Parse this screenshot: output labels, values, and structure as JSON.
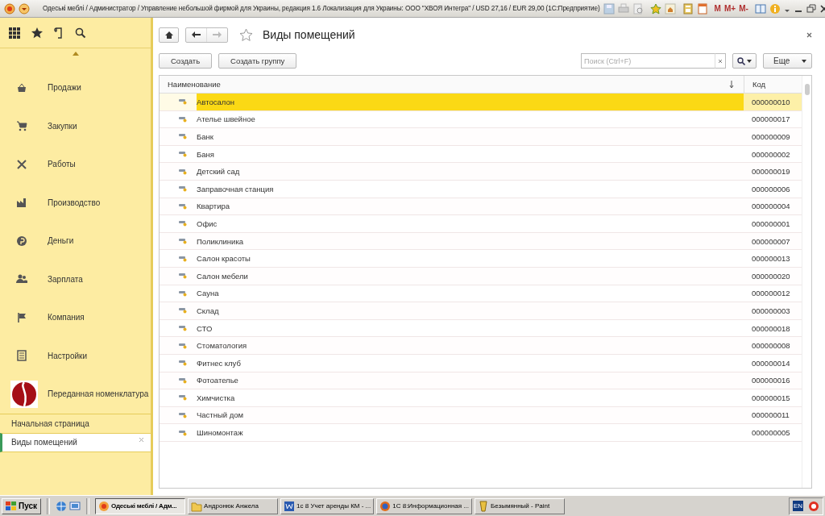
{
  "window": {
    "title": "Одеські меблі / Администратор / Управление небольшой фирмой для Украины, редакция 1.6 Локализация для Украины: ООО \"ХВОЯ Интегра\" / USD 27,16 / EUR 29,00  (1С:Предприятие)",
    "memory_buttons": [
      "M",
      "M+",
      "M-"
    ]
  },
  "sidebar": {
    "sections": [
      {
        "kind": "section",
        "label": "Продажи"
      },
      {
        "kind": "section",
        "label": "Закупки"
      },
      {
        "kind": "section",
        "label": "Работы"
      },
      {
        "kind": "section",
        "label": "Производство"
      },
      {
        "kind": "section",
        "label": "Деньги"
      },
      {
        "kind": "section",
        "label": "Зарплата"
      },
      {
        "kind": "section",
        "label": "Компания"
      },
      {
        "kind": "section",
        "label": "Настройки"
      },
      {
        "kind": "logo",
        "label": "Переданная номенклатура"
      }
    ],
    "open_windows": [
      {
        "label": "Начальная страница",
        "selected": false
      },
      {
        "label": "Виды помещений",
        "selected": true
      }
    ]
  },
  "page": {
    "title": "Виды помещений",
    "buttons": [
      "Создать",
      "Создать группу"
    ],
    "search": {
      "placeholder": "Поиск (Ctrl+F)"
    },
    "more_button": "Еще",
    "table": {
      "columns": [
        {
          "label": "Наименование",
          "sorted": true
        },
        {
          "label": "Код",
          "sorted": false
        }
      ],
      "rows": [
        {
          "name": "Автосалон",
          "code": "000000010",
          "selected": true
        },
        {
          "name": "Ателье швейное",
          "code": "000000017",
          "selected": false
        },
        {
          "name": "Банк",
          "code": "000000009",
          "selected": false
        },
        {
          "name": "Баня",
          "code": "000000002",
          "selected": false
        },
        {
          "name": "Детский сад",
          "code": "000000019",
          "selected": false
        },
        {
          "name": "Заправочная станция",
          "code": "000000006",
          "selected": false
        },
        {
          "name": "Квартира",
          "code": "000000004",
          "selected": false
        },
        {
          "name": "Офис",
          "code": "000000001",
          "selected": false
        },
        {
          "name": "Поликлиника",
          "code": "000000007",
          "selected": false
        },
        {
          "name": "Салон красоты",
          "code": "000000013",
          "selected": false
        },
        {
          "name": "Салон мебели",
          "code": "000000020",
          "selected": false
        },
        {
          "name": "Сауна",
          "code": "000000012",
          "selected": false
        },
        {
          "name": "Склад",
          "code": "000000003",
          "selected": false
        },
        {
          "name": "СТО",
          "code": "000000018",
          "selected": false
        },
        {
          "name": "Стоматология",
          "code": "000000008",
          "selected": false
        },
        {
          "name": "Фитнес клуб",
          "code": "000000014",
          "selected": false
        },
        {
          "name": "Фотоателье",
          "code": "000000016",
          "selected": false
        },
        {
          "name": "Химчистка",
          "code": "000000015",
          "selected": false
        },
        {
          "name": "Частный дом",
          "code": "000000011",
          "selected": false
        },
        {
          "name": "Шиномонтаж",
          "code": "000000005",
          "selected": false
        }
      ]
    }
  },
  "taskbar": {
    "start": "Пуск",
    "tasks": [
      {
        "label": "Одеські меблі / Адм...",
        "selected": true
      },
      {
        "label": "Андронюк Анжела",
        "selected": false
      },
      {
        "label": "1с 8 Учет аренды КМ - ...",
        "selected": false
      },
      {
        "label": "1С 8:Информационная ...",
        "selected": false
      },
      {
        "label": "Безымянный - Paint",
        "selected": false
      }
    ],
    "language": "EN"
  }
}
